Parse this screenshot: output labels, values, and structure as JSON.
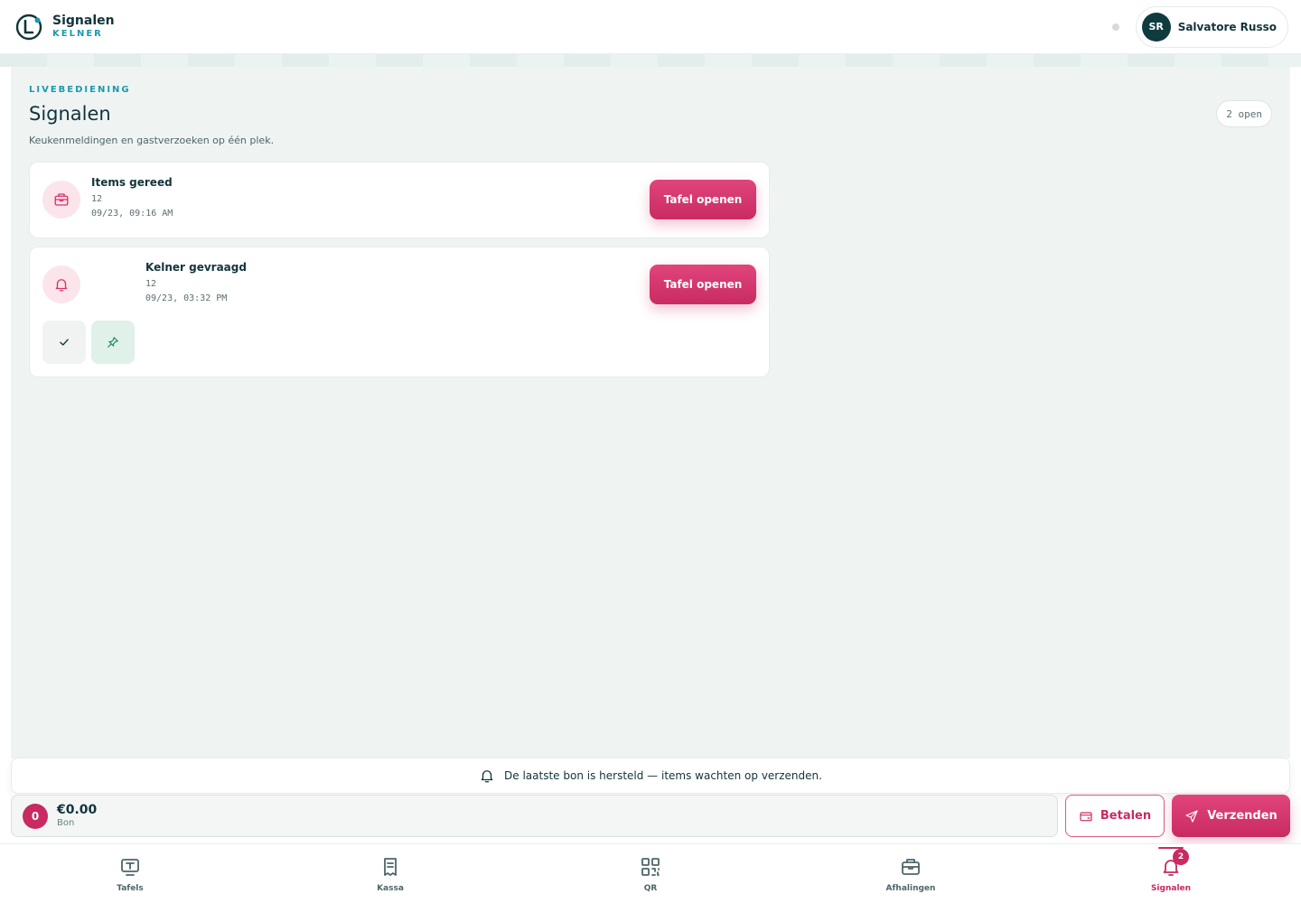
{
  "header": {
    "title": "Signalen",
    "subtitle": "KELNER",
    "user_initials": "SR",
    "user_name": "Salvatore Russo"
  },
  "page": {
    "eyebrow": "LIVEBEDIENING",
    "title": "Signalen",
    "open_count": "2 open",
    "description": "Keukenmeldingen en gastverzoeken op één plek."
  },
  "signals": [
    {
      "title": "Items gereed",
      "table": "12",
      "time": "09/23, 09:16 AM",
      "icon": "package-icon",
      "action_label": "Tafel openen"
    },
    {
      "title": "Kelner gevraagd",
      "table": "12",
      "time": "09/23, 03:32 PM",
      "icon": "bell-icon",
      "action_label": "Tafel openen"
    }
  ],
  "notice": {
    "text": "De laatste bon is hersteld — items wachten op verzenden."
  },
  "order": {
    "count": "0",
    "total": "€0.00",
    "label": "Bon",
    "pay_label": "Betalen",
    "send_label": "Verzenden"
  },
  "nav": {
    "items": [
      {
        "label": "Tafels",
        "icon": "table-icon"
      },
      {
        "label": "Kassa",
        "icon": "receipt-icon"
      },
      {
        "label": "QR",
        "icon": "qr-icon"
      },
      {
        "label": "Afhalingen",
        "icon": "package-icon"
      },
      {
        "label": "Signalen",
        "icon": "bell-icon",
        "badge": "2",
        "active": true
      }
    ]
  },
  "colors": {
    "accent": "#c92a62",
    "brand": "#1b9aaa",
    "dark": "#12343b"
  }
}
